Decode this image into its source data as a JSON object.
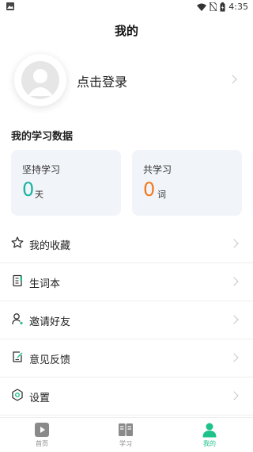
{
  "status_bar": {
    "time": "4:35"
  },
  "page_title": "我的",
  "profile": {
    "login_label": "点击登录"
  },
  "stats": {
    "section_title": "我的学习数据",
    "cards": [
      {
        "label": "坚持学习",
        "value": "0",
        "unit": "天",
        "color": "#1bb5a2"
      },
      {
        "label": "共学习",
        "value": "0",
        "unit": "词",
        "color": "#f27a1d"
      }
    ]
  },
  "menu": [
    {
      "label": "我的收藏",
      "icon": "star-icon"
    },
    {
      "label": "生词本",
      "icon": "notebook-icon"
    },
    {
      "label": "邀请好友",
      "icon": "user-add-icon"
    },
    {
      "label": "意见反馈",
      "icon": "feedback-icon"
    },
    {
      "label": "设置",
      "icon": "settings-icon"
    }
  ],
  "tabs": [
    {
      "label": "首页",
      "icon": "play-icon",
      "active": false
    },
    {
      "label": "学习",
      "icon": "book-icon",
      "active": false
    },
    {
      "label": "我的",
      "icon": "person-icon",
      "active": true
    }
  ],
  "colors": {
    "accent": "#1ec28b",
    "inactive": "#8a8a8a"
  }
}
